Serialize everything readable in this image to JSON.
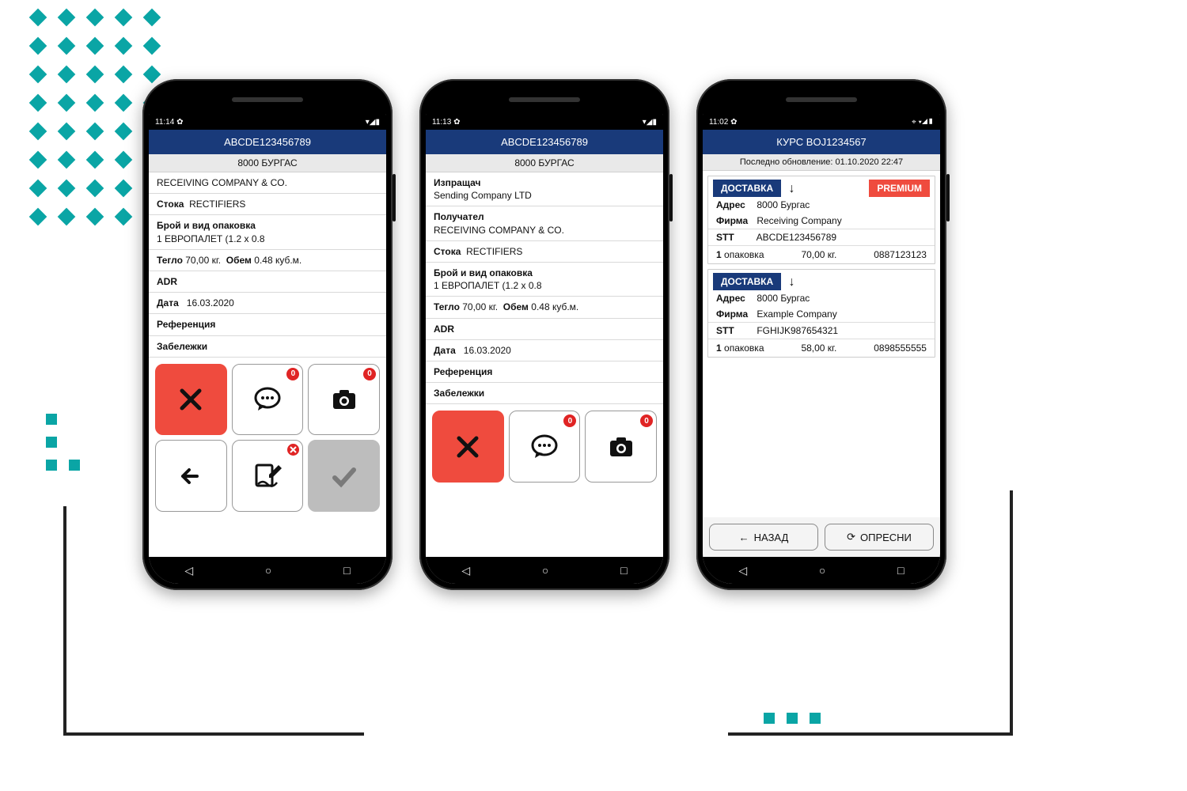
{
  "decor": {
    "diamond_size": 16,
    "diamond_gap": 36
  },
  "phones": {
    "p1": {
      "time": "11:14",
      "title": "ABCDE123456789",
      "subtitle": "8000 БУРГАС",
      "company": "RECEIVING COMPANY & CO.",
      "goods_label": "Стока",
      "goods_value": "RECTIFIERS",
      "pack_label": "Брой и вид опаковка",
      "pack_value": "1 ЕВРОПАЛЕТ (1.2 x 0.8",
      "weight_label": "Тегло",
      "weight_value": "70,00 кг.",
      "vol_label": "Обем",
      "vol_value": "0.48 куб.м.",
      "adr": "ADR",
      "date_label": "Дата",
      "date_value": "16.03.2020",
      "ref": "Референция",
      "notes": "Забележки",
      "badges": {
        "chat": "0",
        "cam": "0"
      }
    },
    "p2": {
      "time": "11:13",
      "title": "ABCDE123456789",
      "subtitle": "8000 БУРГАС",
      "sender_label": "Изпращач",
      "sender_value": "Sending Company LTD",
      "recv_label": "Получател",
      "recv_value": "RECEIVING COMPANY & CO.",
      "goods_label": "Стока",
      "goods_value": "RECTIFIERS",
      "pack_label": "Брой и вид опаковка",
      "pack_value": "1 ЕВРОПАЛЕТ (1.2 x 0.8",
      "weight_label": "Тегло",
      "weight_value": "70,00 кг.",
      "vol_label": "Обем",
      "vol_value": "0.48 куб.м.",
      "adr": "ADR",
      "date_label": "Дата",
      "date_value": "16.03.2020",
      "ref": "Референция",
      "notes": "Забележки",
      "badges": {
        "chat": "0",
        "cam": "0"
      }
    },
    "p3": {
      "time": "11:02",
      "title": "КУРС BOJ1234567",
      "updated": "Последно обновление: 01.10.2020 22:47",
      "delivery_label": "ДОСТАВКА",
      "premium": "PREMIUM",
      "d1": {
        "addr_label": "Адрес",
        "addr": "8000 Бургас",
        "firm_label": "Фирма",
        "firm": "Receiving Company",
        "stt_label": "STT",
        "stt": "ABCDE123456789",
        "pkg": "1 опаковка",
        "weight": "70,00 кг.",
        "phone": "0887123123"
      },
      "d2": {
        "addr_label": "Адрес",
        "addr": "8000 Бургас",
        "firm_label": "Фирма",
        "firm": "Example Company",
        "stt_label": "STT",
        "stt": "FGHIJK987654321",
        "pkg": "1 опаковка",
        "weight": "58,00 кг.",
        "phone": "0898555555"
      },
      "back": "НАЗАД",
      "refresh": "ОПРЕСНИ"
    }
  }
}
